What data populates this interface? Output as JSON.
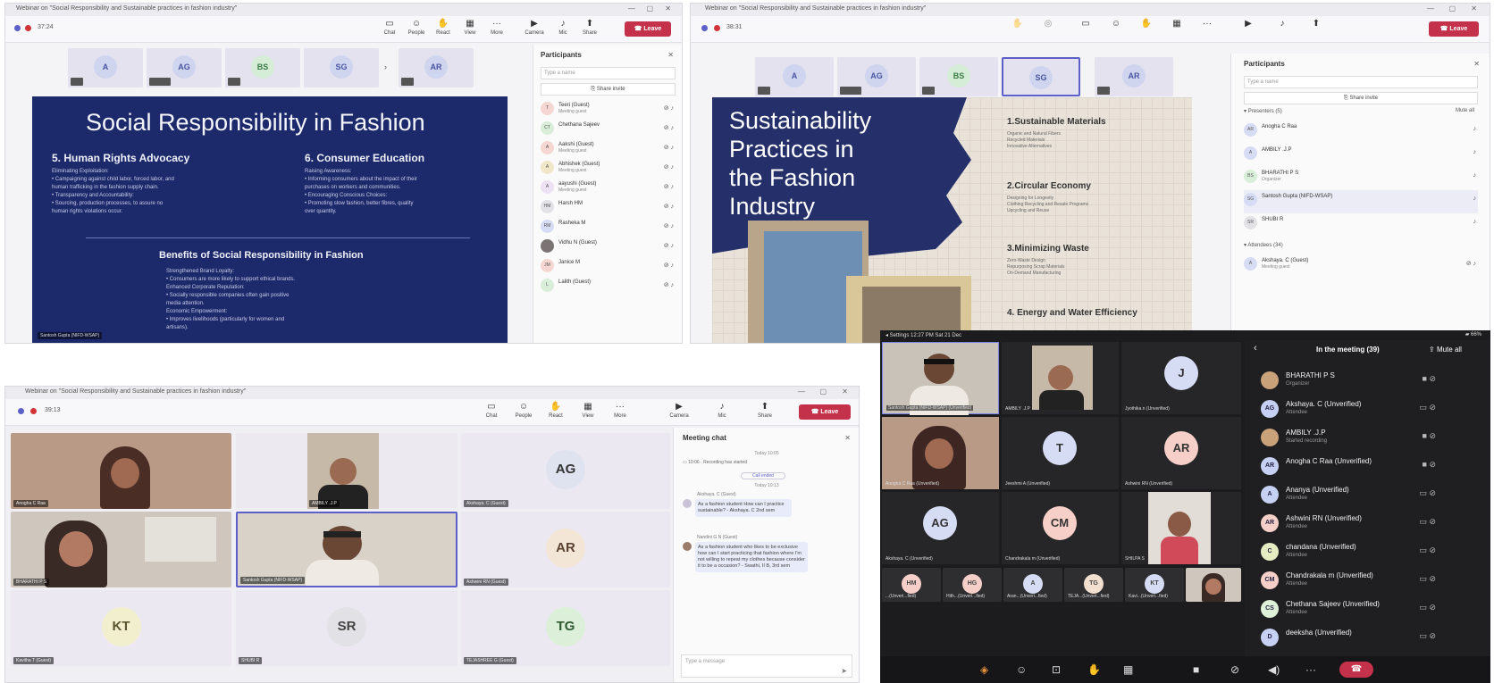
{
  "w1": {
    "title": "Webinar on \"Social Responsibility and Sustainable practices in fashion industry\"",
    "timer": "37:24",
    "toolbar": [
      "Chat",
      "People",
      "React",
      "View",
      "More",
      "Camera",
      "Mic",
      "Share"
    ],
    "leave": "Leave",
    "tiles": [
      "A",
      "AG",
      "BS",
      "SG",
      "AR"
    ],
    "slide": {
      "title": "Social Responsibility in Fashion",
      "h5": "5. Human Rights Advocacy",
      "h5_text": [
        "Eliminating Exploitation:",
        "• Campaigning against child labor, forced labor, and",
        "  human trafficking in the fashion supply chain.",
        "• Transparency and Accountability:",
        "• Sourcing, production processes, to assure no",
        "  human rights violations occur."
      ],
      "h6": "6. Consumer Education",
      "h6_text": [
        "Raising Awareness:",
        "• Informing consumers about the impact of their",
        "  purchases on workers and communities.",
        "• Encouraging Conscious Choices:",
        "• Promoting slow fashion, better fibres, quality",
        "  over quantity."
      ],
      "benefits": "Benefits of Social Responsibility in Fashion",
      "benefits_text": [
        "Strengthened Brand Loyalty:",
        "• Consumers are more likely to support ethical brands.",
        "Enhanced Corporate Reputation:",
        "• Socially responsible companies often gain positive",
        "  media attention.",
        "Economic Empowerment:",
        "• Improves livelihoods (particularly for women and",
        "  artisans)."
      ],
      "presenter": "Santosh Gupta (NIFD-WSAP)"
    },
    "participants_title": "Participants",
    "search": "Type a name",
    "share_invite": "Share invite",
    "participants": [
      {
        "i": "T",
        "n": "Teeri (Guest)",
        "s": "Meeting guest"
      },
      {
        "i": "CT",
        "n": "Chethana Sajeev",
        "s": ""
      },
      {
        "i": "A",
        "n": "Aakshi (Guest)",
        "s": "Meeting guest"
      },
      {
        "i": "A",
        "n": "Abhishek (Guest)",
        "s": "Meeting guest"
      },
      {
        "i": "A",
        "n": "aayushi (Guest)",
        "s": "Meeting guest"
      },
      {
        "i": "HM",
        "n": "Harsh HM",
        "s": ""
      },
      {
        "i": "RM",
        "n": "Rasheka M",
        "s": ""
      },
      {
        "i": "",
        "n": "Vidhu N (Guest)",
        "s": ""
      },
      {
        "i": "JM",
        "n": "Janice M",
        "s": ""
      },
      {
        "i": "L",
        "n": "Lalith (Guest)",
        "s": ""
      }
    ]
  },
  "w2": {
    "title": "Webinar on \"Social Responsibility and Sustainable practices in fashion industry\"",
    "timer": "38:31",
    "leave": "Leave",
    "tiles": [
      "A",
      "AG",
      "BS",
      "SG",
      "AR"
    ],
    "slide": {
      "title_lines": [
        "Sustainability",
        "Practices in",
        "the Fashion",
        "Industry"
      ],
      "h1": "1.Sustainable Materials",
      "t1": [
        "Organic and Natural Fibers",
        "Recycled Materials",
        "Innovative Alternatives"
      ],
      "h2": "2.Circular Economy",
      "t2": [
        "Designing for Longevity",
        "Clothing Recycling and Resale Programs",
        "Upcycling and Reuse"
      ],
      "h3": "3.Minimizing Waste",
      "t3": [
        "Zero-Waste Design",
        "Repurposing Scrap Materials",
        "On-Demand Manufacturing"
      ],
      "h4": "4. Energy and Water Efficiency"
    },
    "participants_title": "Participants",
    "search": "Type a name",
    "share_invite": "Share invite",
    "presenters_label": "Presenters (5)",
    "mute_all": "Mute all",
    "participants": [
      {
        "i": "AR",
        "n": "Anogha C Raa",
        "s": ""
      },
      {
        "i": "A",
        "n": "AMBILY .J.P",
        "s": ""
      },
      {
        "i": "BS",
        "n": "BHARATHI P S",
        "s": "Organizer"
      },
      {
        "i": "SG",
        "n": "Santosh Gupta (NIFD-WSAP)",
        "s": ""
      },
      {
        "i": "SR",
        "n": "SHUBI R",
        "s": ""
      }
    ],
    "attendees_label": "Attendees (34)",
    "attendee": {
      "i": "A",
      "n": "Akshaya. C (Guest)",
      "s": "Meeting guest"
    }
  },
  "w3": {
    "title": "Webinar on \"Social Responsibility and Sustainable practices in fashion industry\"",
    "timer": "39:13",
    "toolbar": [
      "Chat",
      "People",
      "React",
      "View",
      "More",
      "Camera",
      "Mic",
      "Share"
    ],
    "leave": "Leave",
    "tiles": [
      {
        "n": "Anogha C Raa",
        "a": ""
      },
      {
        "n": "AMBILY .J.P",
        "a": ""
      },
      {
        "n": "Akshaya. C (Guest)",
        "a": "AG"
      },
      {
        "n": "BHARATHI P S",
        "a": ""
      },
      {
        "n": "Santosh Gupta (NIFD-WSAP)",
        "a": ""
      },
      {
        "n": "Ashwini RN (Guest)",
        "a": "AR"
      },
      {
        "n": "Kavitha T (Guest)",
        "a": "KT"
      },
      {
        "n": "SHUBI R",
        "a": "SR"
      },
      {
        "n": "TEJASHREE G (Guest)",
        "a": "TG"
      }
    ],
    "chat_title": "Meeting chat",
    "chat_day": "Today 10:05",
    "chat_rec": "10:06 · Recording has started",
    "chat_call": "Call ended",
    "chat_day2": "Today 10:13",
    "msg1_from": "Akshaya. C (Guest)",
    "msg1": "As a fashion student How can I practice sustainable? - Akshaya. C 2nd sem",
    "msg2_from": "Nandini G N (Guest)",
    "msg2": "As a fashion student who likes to be exclusive how can I start practicing that fashion where I'm not willing to repeat my clothes because consider it to be a occasion? - Swathi, II B, 3rd sem",
    "chat_placeholder": "Type a message"
  },
  "w4": {
    "status_left": "◂ Settings  12:27 PM  Sat 21 Dec",
    "status_right": "66%",
    "tiles": [
      {
        "n": "Santosh Gupta (NIFD-WSAP) (Unverified)",
        "a": ""
      },
      {
        "n": "AMBILY .J.P",
        "a": ""
      },
      {
        "n": "Jyothika.n (Unverified)",
        "a": "J"
      },
      {
        "n": "Anogha C Raa (Unverified)",
        "a": ""
      },
      {
        "n": "Jeeshmi A (Unverified)",
        "a": "T"
      },
      {
        "n": "Ashwini RN (Unverified)",
        "a": "AR"
      },
      {
        "n": "Akshaya. C (Unverified)",
        "a": "AG"
      },
      {
        "n": "Chandrakala m (Unverified)",
        "a": "CM"
      },
      {
        "n": "SHILPA S",
        "a": ""
      }
    ],
    "small_tiles": [
      {
        "a": "HM",
        "n": "...(Unveri...fied)"
      },
      {
        "a": "HG",
        "n": "Hith...(Unveri...fied)"
      },
      {
        "a": "A",
        "n": "Aran...(Unveri...fied)"
      },
      {
        "a": "TG",
        "n": "TEJA...(Unveri...fied)"
      },
      {
        "a": "KT",
        "n": "Kavi...(Unveri...fied)"
      }
    ],
    "list_title": "In the meeting (39)",
    "mute_all": "Mute all",
    "people": [
      {
        "i": "",
        "n": "BHARATHI P S",
        "r": "Organizer",
        "c": "#c9a27a"
      },
      {
        "i": "AG",
        "n": "Akshaya. C (Unverified)",
        "r": "Attendee",
        "c": "#c6d0f2"
      },
      {
        "i": "",
        "n": "AMBILY .J.P",
        "r": "Started recording",
        "c": "#c9a27a"
      },
      {
        "i": "AR",
        "n": "Anogha C Raa (Unverified)",
        "r": "",
        "c": "#c6d0f2"
      },
      {
        "i": "A",
        "n": "Ananya (Unverified)",
        "r": "Attendee",
        "c": "#c6d0f2"
      },
      {
        "i": "AR",
        "n": "Ashwini RN (Unverified)",
        "r": "Attendee",
        "c": "#f5cfc8"
      },
      {
        "i": "C",
        "n": "chandana (Unverified)",
        "r": "Attendee",
        "c": "#e6ecc2"
      },
      {
        "i": "CM",
        "n": "Chandrakala m (Unverified)",
        "r": "Attendee",
        "c": "#f5cfc8"
      },
      {
        "i": "CS",
        "n": "Chethana Sajeev (Unverified)",
        "r": "Attendee",
        "c": "#dff0d8"
      },
      {
        "i": "D",
        "n": "deeksha (Unverified)",
        "r": "",
        "c": "#c6d0f2"
      }
    ]
  }
}
